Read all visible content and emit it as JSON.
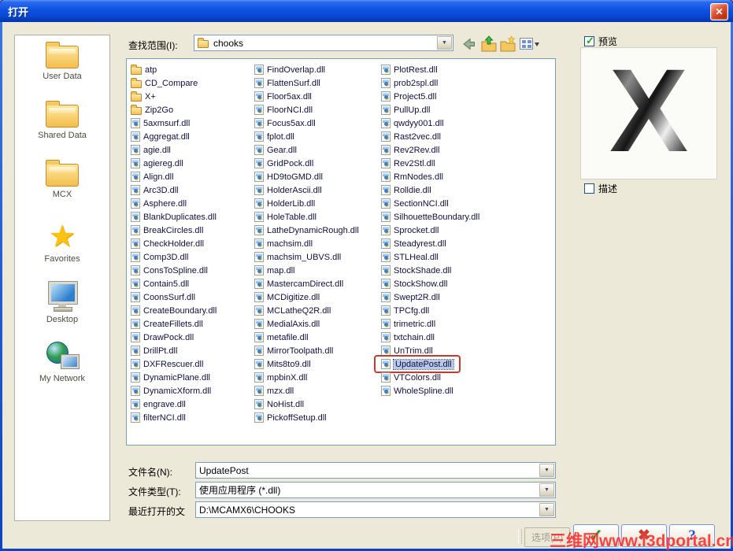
{
  "window": {
    "title": "打开"
  },
  "icons": {
    "close": "✕",
    "dropdown": "▼",
    "back": "left-arrow-icon",
    "up": "folder-up-icon",
    "new_folder": "new-folder-icon",
    "views": "view-menu-icon",
    "check_small": "✓",
    "star": "★"
  },
  "toolbar": {
    "look_in_label": "查找范围(I):",
    "look_in_value": "chooks"
  },
  "places": [
    {
      "label": "User Data",
      "icon": "folder"
    },
    {
      "label": "Shared Data",
      "icon": "folder"
    },
    {
      "label": "MCX",
      "icon": "folder"
    },
    {
      "label": "Favorites",
      "icon": "star"
    },
    {
      "label": "Desktop",
      "icon": "desktop"
    },
    {
      "label": "My Network",
      "icon": "network"
    }
  ],
  "file_list": {
    "selected": "UpdatePost.dll",
    "columns": [
      {
        "items": [
          {
            "name": "atp",
            "type": "folder"
          },
          {
            "name": "CD_Compare",
            "type": "folder"
          },
          {
            "name": "X+",
            "type": "folder"
          },
          {
            "name": "Zip2Go",
            "type": "folder"
          },
          {
            "name": "5axmsurf.dll",
            "type": "dll"
          },
          {
            "name": "Aggregat.dll",
            "type": "dll"
          },
          {
            "name": "agie.dll",
            "type": "dll"
          },
          {
            "name": "agiereg.dll",
            "type": "dll"
          },
          {
            "name": "Align.dll",
            "type": "dll"
          },
          {
            "name": "Arc3D.dll",
            "type": "dll"
          },
          {
            "name": "Asphere.dll",
            "type": "dll"
          },
          {
            "name": "BlankDuplicates.dll",
            "type": "dll"
          },
          {
            "name": "BreakCircles.dll",
            "type": "dll"
          },
          {
            "name": "CheckHolder.dll",
            "type": "dll"
          },
          {
            "name": "Comp3D.dll",
            "type": "dll"
          },
          {
            "name": "ConsToSpline.dll",
            "type": "dll"
          },
          {
            "name": "Contain5.dll",
            "type": "dll"
          },
          {
            "name": "CoonsSurf.dll",
            "type": "dll"
          },
          {
            "name": "CreateBoundary.dll",
            "type": "dll"
          },
          {
            "name": "CreateFillets.dll",
            "type": "dll"
          },
          {
            "name": "DrawPock.dll",
            "type": "dll"
          },
          {
            "name": "DrillPt.dll",
            "type": "dll"
          },
          {
            "name": "DXFRescuer.dll",
            "type": "dll"
          },
          {
            "name": "DynamicPlane.dll",
            "type": "dll"
          },
          {
            "name": "DynamicXform.dll",
            "type": "dll"
          },
          {
            "name": "engrave.dll",
            "type": "dll"
          },
          {
            "name": "filterNCI.dll",
            "type": "dll"
          }
        ]
      },
      {
        "items": [
          {
            "name": "FindOverlap.dll",
            "type": "dll"
          },
          {
            "name": "FlattenSurf.dll",
            "type": "dll"
          },
          {
            "name": "Floor5ax.dll",
            "type": "dll"
          },
          {
            "name": "FloorNCI.dll",
            "type": "dll"
          },
          {
            "name": "Focus5ax.dll",
            "type": "dll"
          },
          {
            "name": "fplot.dll",
            "type": "dll"
          },
          {
            "name": "Gear.dll",
            "type": "dll"
          },
          {
            "name": "GridPock.dll",
            "type": "dll"
          },
          {
            "name": "HD9toGMD.dll",
            "type": "dll"
          },
          {
            "name": "HolderAscii.dll",
            "type": "dll"
          },
          {
            "name": "HolderLib.dll",
            "type": "dll"
          },
          {
            "name": "HoleTable.dll",
            "type": "dll"
          },
          {
            "name": "LatheDynamicRough.dll",
            "type": "dll"
          },
          {
            "name": "machsim.dll",
            "type": "dll"
          },
          {
            "name": "machsim_UBVS.dll",
            "type": "dll"
          },
          {
            "name": "map.dll",
            "type": "dll"
          },
          {
            "name": "MastercamDirect.dll",
            "type": "dll"
          },
          {
            "name": "MCDigitize.dll",
            "type": "dll"
          },
          {
            "name": "MCLatheQ2R.dll",
            "type": "dll"
          },
          {
            "name": "MedialAxis.dll",
            "type": "dll"
          },
          {
            "name": "metafile.dll",
            "type": "dll"
          },
          {
            "name": "MirrorToolpath.dll",
            "type": "dll"
          },
          {
            "name": "Mits8to9.dll",
            "type": "dll"
          },
          {
            "name": "mpbinX.dll",
            "type": "dll"
          },
          {
            "name": "mzx.dll",
            "type": "dll"
          },
          {
            "name": "NoHist.dll",
            "type": "dll"
          },
          {
            "name": "PickoffSetup.dll",
            "type": "dll"
          }
        ]
      },
      {
        "items": [
          {
            "name": "PlotRest.dll",
            "type": "dll"
          },
          {
            "name": "prob2spl.dll",
            "type": "dll"
          },
          {
            "name": "Project5.dll",
            "type": "dll"
          },
          {
            "name": "PullUp.dll",
            "type": "dll"
          },
          {
            "name": "qwdyy001.dll",
            "type": "dll"
          },
          {
            "name": "Rast2vec.dll",
            "type": "dll"
          },
          {
            "name": "Rev2Rev.dll",
            "type": "dll"
          },
          {
            "name": "Rev2Stl.dll",
            "type": "dll"
          },
          {
            "name": "RmNodes.dll",
            "type": "dll"
          },
          {
            "name": "Rolldie.dll",
            "type": "dll"
          },
          {
            "name": "SectionNCI.dll",
            "type": "dll"
          },
          {
            "name": "SilhouetteBoundary.dll",
            "type": "dll"
          },
          {
            "name": "Sprocket.dll",
            "type": "dll"
          },
          {
            "name": "Steadyrest.dll",
            "type": "dll"
          },
          {
            "name": "STLHeal.dll",
            "type": "dll"
          },
          {
            "name": "StockShade.dll",
            "type": "dll"
          },
          {
            "name": "StockShow.dll",
            "type": "dll"
          },
          {
            "name": "Swept2R.dll",
            "type": "dll"
          },
          {
            "name": "TPCfg.dll",
            "type": "dll"
          },
          {
            "name": "trimetric.dll",
            "type": "dll"
          },
          {
            "name": "txtchain.dll",
            "type": "dll"
          },
          {
            "name": "UnTrim.dll",
            "type": "dll"
          },
          {
            "name": "UpdatePost.dll",
            "type": "dll"
          },
          {
            "name": "VTColors.dll",
            "type": "dll"
          },
          {
            "name": "WholeSpline.dll",
            "type": "dll"
          }
        ]
      }
    ]
  },
  "preview": {
    "preview_label": "预览",
    "description_label": "描述",
    "logo_text": "X"
  },
  "form": {
    "file_name_label": "文件名(N):",
    "file_name_value": "UpdatePost",
    "file_type_label": "文件类型(T):",
    "file_type_value": "使用应用程序 (*.dll)",
    "recent_label": "最近打开的文",
    "recent_value": "D:\\MCAMX6\\CHOOKS"
  },
  "buttons": {
    "options_label": "选项(P)",
    "ok_glyph": "✓",
    "cancel_glyph": "✖",
    "help_glyph": "?"
  },
  "watermark": {
    "text": "三维网www.i3dportal.cn"
  },
  "colors": {
    "titlebar_blue": "#0d52e4",
    "dialog_bg": "#ECE9D8",
    "selection_bg": "#b7c8ea",
    "annotation_red": "#c43b2e",
    "ok_green": "#18981f",
    "cancel_red": "#d03b30",
    "help_blue": "#2a50c8"
  }
}
